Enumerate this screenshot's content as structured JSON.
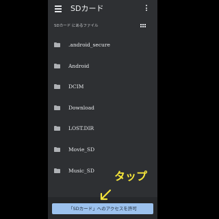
{
  "appbar": {
    "title": "SDカード",
    "menu_icon": "hamburger-menu-icon",
    "more_icon": "more-vert-icon"
  },
  "subheader": {
    "text": "SDカード にあるファイル",
    "view_toggle_icon": "grid-view-icon"
  },
  "files": [
    {
      "name": ".android_secure",
      "icon": "folder-icon"
    },
    {
      "name": "Android",
      "icon": "folder-icon"
    },
    {
      "name": "DCIM",
      "icon": "folder-icon"
    },
    {
      "name": "Download",
      "icon": "folder-icon"
    },
    {
      "name": "LOST.DIR",
      "icon": "folder-icon"
    },
    {
      "name": "Movie_SD",
      "icon": "folder-icon"
    },
    {
      "name": "Music_SD",
      "icon": "folder-icon"
    }
  ],
  "bottom": {
    "access_button_label": "「SDカード」へのアクセスを許可"
  },
  "annotation": {
    "text": "タップ",
    "color": "#f5e53a"
  },
  "colors": {
    "background": "#2e3033",
    "button": "#9cc2ee"
  }
}
